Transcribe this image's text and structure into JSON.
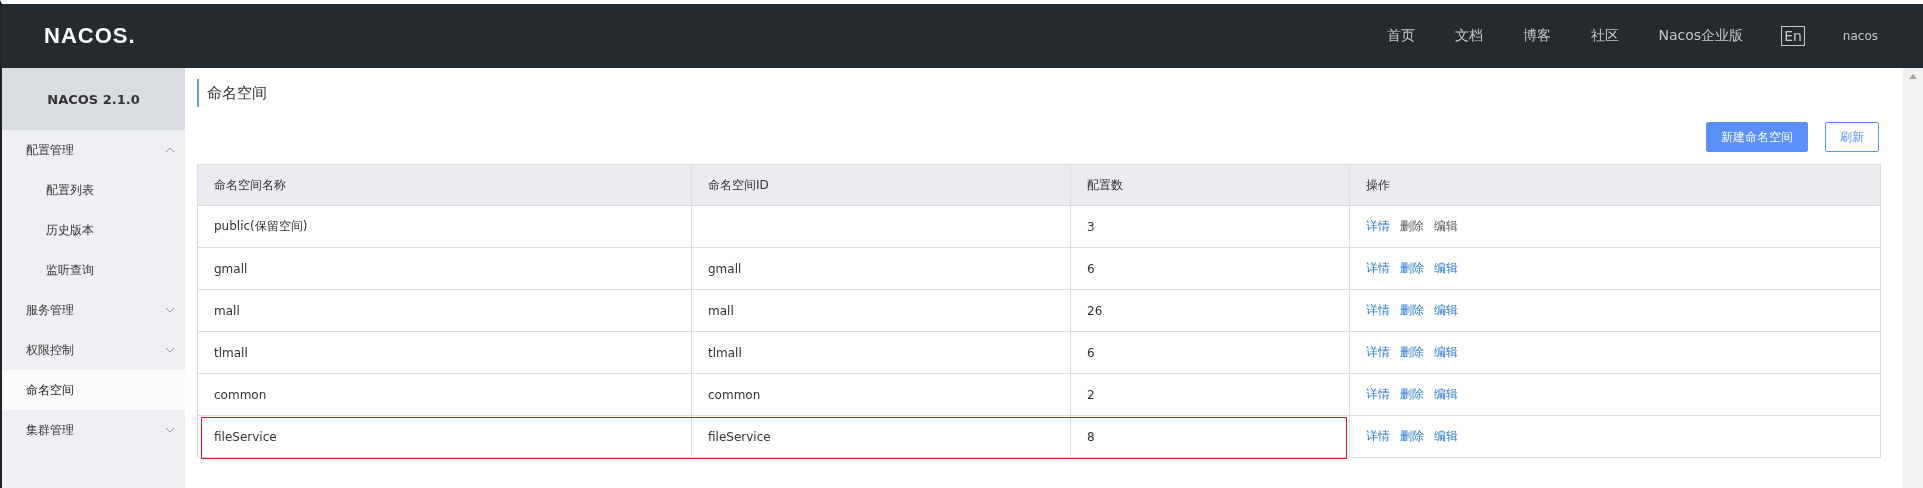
{
  "header": {
    "logo": "NACOS.",
    "nav": [
      "首页",
      "文档",
      "博客",
      "社区",
      "Nacos企业版"
    ],
    "language": "En",
    "user": "nacos"
  },
  "sidebar": {
    "title": "NACOS 2.1.0",
    "items": [
      {
        "label": "配置管理",
        "selected": false,
        "expanded": true,
        "children": [
          {
            "label": "配置列表",
            "selected": false
          },
          {
            "label": "历史版本",
            "selected": false
          },
          {
            "label": "监听查询",
            "selected": false
          }
        ]
      },
      {
        "label": "服务管理",
        "selected": false,
        "expanded": false
      },
      {
        "label": "权限控制",
        "selected": false,
        "expanded": false
      },
      {
        "label": "命名空间",
        "selected": true
      },
      {
        "label": "集群管理",
        "selected": false,
        "expanded": false
      }
    ]
  },
  "page": {
    "title": "命名空间",
    "buttons": [
      {
        "label": "新建命名空间",
        "kind": "primary"
      },
      {
        "label": "刷新",
        "kind": "outline"
      }
    ]
  },
  "table": {
    "columns": [
      "命名空间名称",
      "命名空间ID",
      "配置数",
      "操作"
    ],
    "rows": [
      {
        "name": "public(保留空间)",
        "id": "",
        "count": "3",
        "highlighted": false,
        "actions": [
          {
            "label": "详情",
            "disabled": false
          },
          {
            "label": "删除",
            "disabled": true
          },
          {
            "label": "编辑",
            "disabled": true
          }
        ]
      },
      {
        "name": "gmall",
        "id": "gmall",
        "count": "6",
        "highlighted": false,
        "actions": [
          {
            "label": "详情",
            "disabled": false
          },
          {
            "label": "删除",
            "disabled": false
          },
          {
            "label": "编辑",
            "disabled": false
          }
        ]
      },
      {
        "name": "mall",
        "id": "mall",
        "count": "26",
        "highlighted": false,
        "actions": [
          {
            "label": "详情",
            "disabled": false
          },
          {
            "label": "删除",
            "disabled": false
          },
          {
            "label": "编辑",
            "disabled": false
          }
        ]
      },
      {
        "name": "tlmall",
        "id": "tlmall",
        "count": "6",
        "highlighted": false,
        "actions": [
          {
            "label": "详情",
            "disabled": false
          },
          {
            "label": "删除",
            "disabled": false
          },
          {
            "label": "编辑",
            "disabled": false
          }
        ]
      },
      {
        "name": "common",
        "id": "common",
        "count": "2",
        "highlighted": false,
        "actions": [
          {
            "label": "详情",
            "disabled": false
          },
          {
            "label": "删除",
            "disabled": false
          },
          {
            "label": "编辑",
            "disabled": false
          }
        ]
      },
      {
        "name": "fileService",
        "id": "fileService",
        "count": "8",
        "highlighted": true,
        "actions": [
          {
            "label": "详情",
            "disabled": false
          },
          {
            "label": "删除",
            "disabled": false
          },
          {
            "label": "编辑",
            "disabled": false
          }
        ]
      }
    ]
  }
}
